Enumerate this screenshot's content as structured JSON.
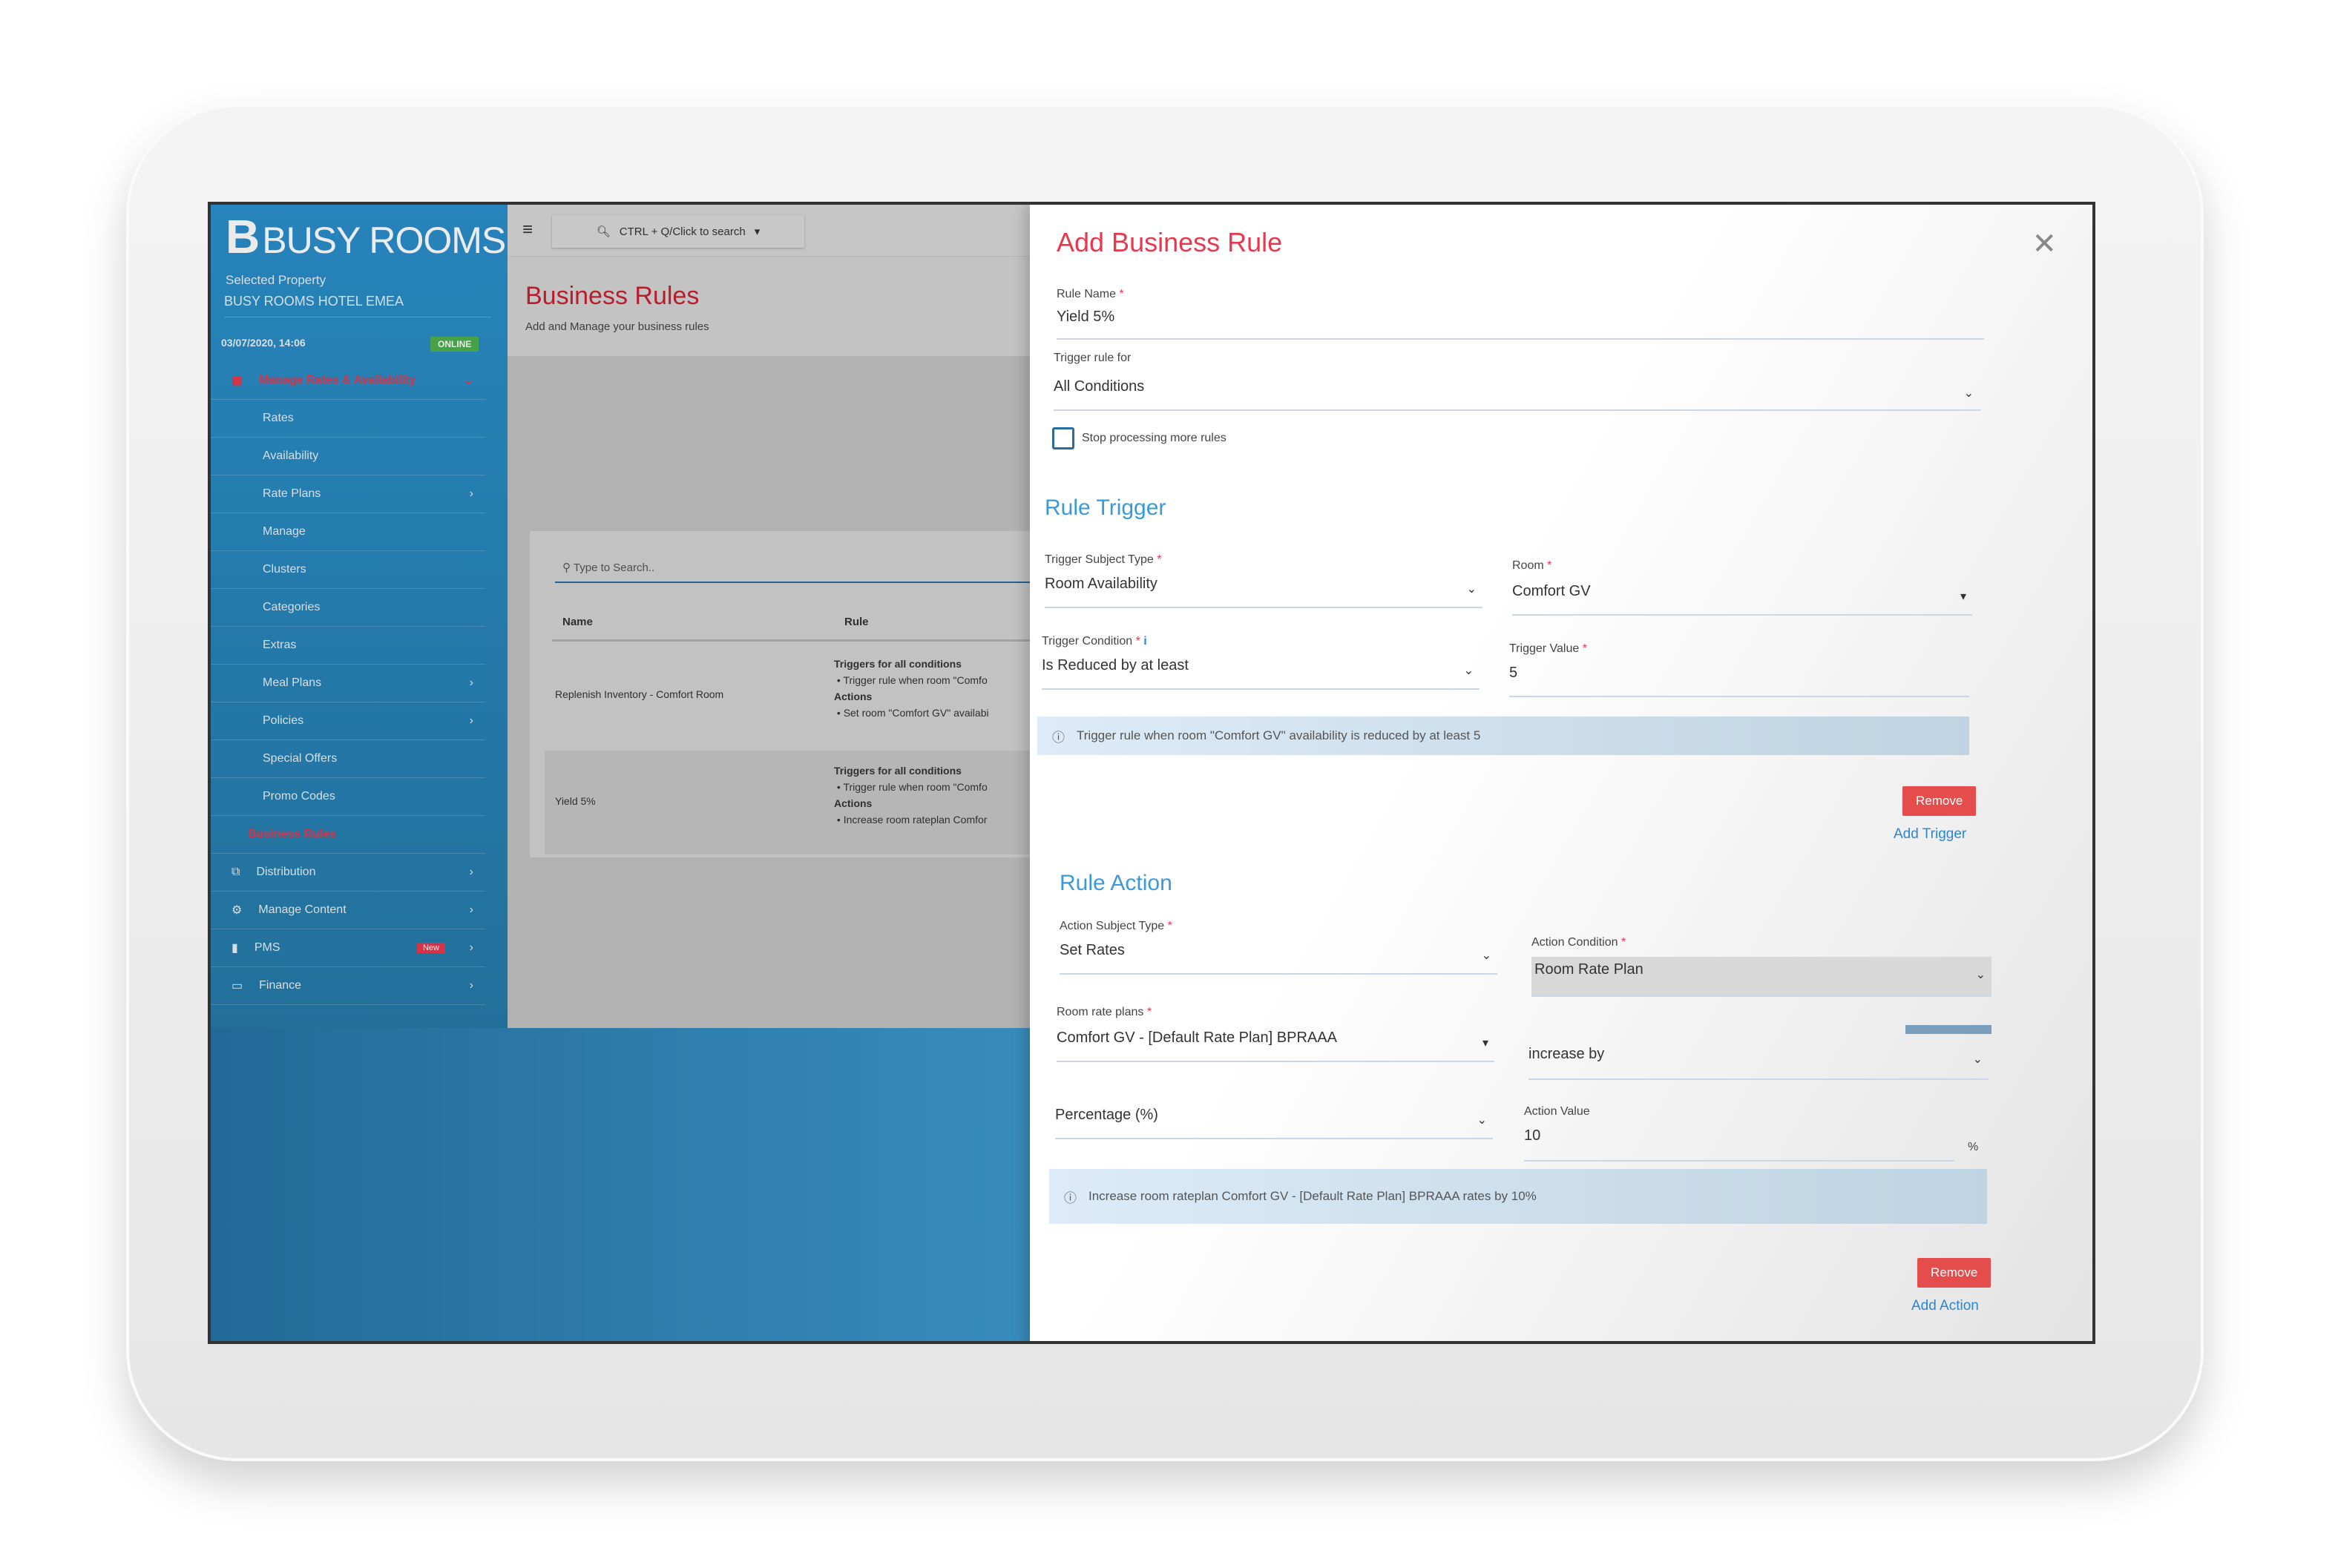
{
  "brand": {
    "logo_text": "BUSY ROOMS",
    "accent": "#e8384f",
    "primary": "#2b8fcb"
  },
  "sidebar": {
    "selected_property_label": "Selected Property",
    "selected_property": "BUSY ROOMS HOTEL EMEA",
    "datetime": "03/07/2020, 14:06",
    "status": "ONLINE",
    "items": [
      {
        "label": "Manage Rates & Availability",
        "active": true,
        "chevron": "⌄",
        "icon": "calendar-icon"
      },
      {
        "label": "Rates"
      },
      {
        "label": "Availability"
      },
      {
        "label": "Rate Plans",
        "chevron": "›"
      },
      {
        "label": "Manage"
      },
      {
        "label": "Clusters"
      },
      {
        "label": "Categories"
      },
      {
        "label": "Extras"
      },
      {
        "label": "Meal Plans",
        "chevron": "›"
      },
      {
        "label": "Policies",
        "chevron": "›"
      },
      {
        "label": "Special Offers"
      },
      {
        "label": "Promo Codes"
      },
      {
        "label": "Business Rules",
        "active": true
      },
      {
        "label": "Distribution",
        "chevron": "›",
        "icon": "sitemap-icon"
      },
      {
        "label": "Manage Content",
        "chevron": "›",
        "icon": "gear-icon"
      },
      {
        "label": "PMS",
        "chevron": "›",
        "badge": "New",
        "icon": "building-icon"
      },
      {
        "label": "Finance",
        "chevron": "›",
        "icon": "card-icon"
      }
    ]
  },
  "topbar": {
    "search_label": "CTRL + Q/Click to search"
  },
  "page": {
    "title": "Business Rules",
    "subtitle": "Add and Manage your business rules",
    "search_placeholder": "Type to Search..",
    "columns": [
      "Name",
      "Rule"
    ],
    "rows": [
      {
        "name": "Replenish Inventory - Comfort Room",
        "trigger_heading": "Triggers for all conditions",
        "trigger": "Trigger rule when room \"Comfo",
        "action_heading": "Actions",
        "action": "Set room \"Comfort GV\" availabi"
      },
      {
        "name": "Yield 5%",
        "trigger_heading": "Triggers for all conditions",
        "trigger": "Trigger rule when room \"Comfo",
        "action_heading": "Actions",
        "action": "Increase room rateplan Comfor"
      }
    ]
  },
  "modal": {
    "title": "Add Business Rule",
    "rule_name_label": "Rule Name",
    "rule_name": "Yield 5%",
    "trigger_for_label": "Trigger rule for",
    "trigger_for": "All Conditions",
    "stop_label": "Stop processing more rules",
    "stop_checked": false,
    "trigger_section": "Rule Trigger",
    "subject_type_label": "Trigger Subject Type",
    "subject_type": "Room Availability",
    "room_label": "Room",
    "room": "Comfort GV",
    "condition_label": "Trigger Condition",
    "condition": "Is Reduced by at least",
    "trigger_value_label": "Trigger Value",
    "trigger_value": "5",
    "trigger_info": "Trigger rule when room \"Comfort GV\" availability is reduced by at least 5",
    "remove_label": "Remove",
    "add_trigger": "Add Trigger",
    "action_section": "Rule Action",
    "action_subject_label": "Action Subject Type",
    "action_subject": "Set Rates",
    "action_condition_label": "Action Condition",
    "action_condition": "Room Rate Plan",
    "rate_plans_label": "Room rate plans",
    "rate_plan": "Comfort GV - [Default Rate Plan] BPRAAA",
    "direction": "increase by",
    "unit_type": "Percentage (%)",
    "action_value_label": "Action Value",
    "action_value": "10",
    "unit": "%",
    "action_info": "Increase room rateplan Comfort GV - [Default Rate Plan] BPRAAA rates by 10%",
    "add_action": "Add Action",
    "required_mark": "*"
  }
}
